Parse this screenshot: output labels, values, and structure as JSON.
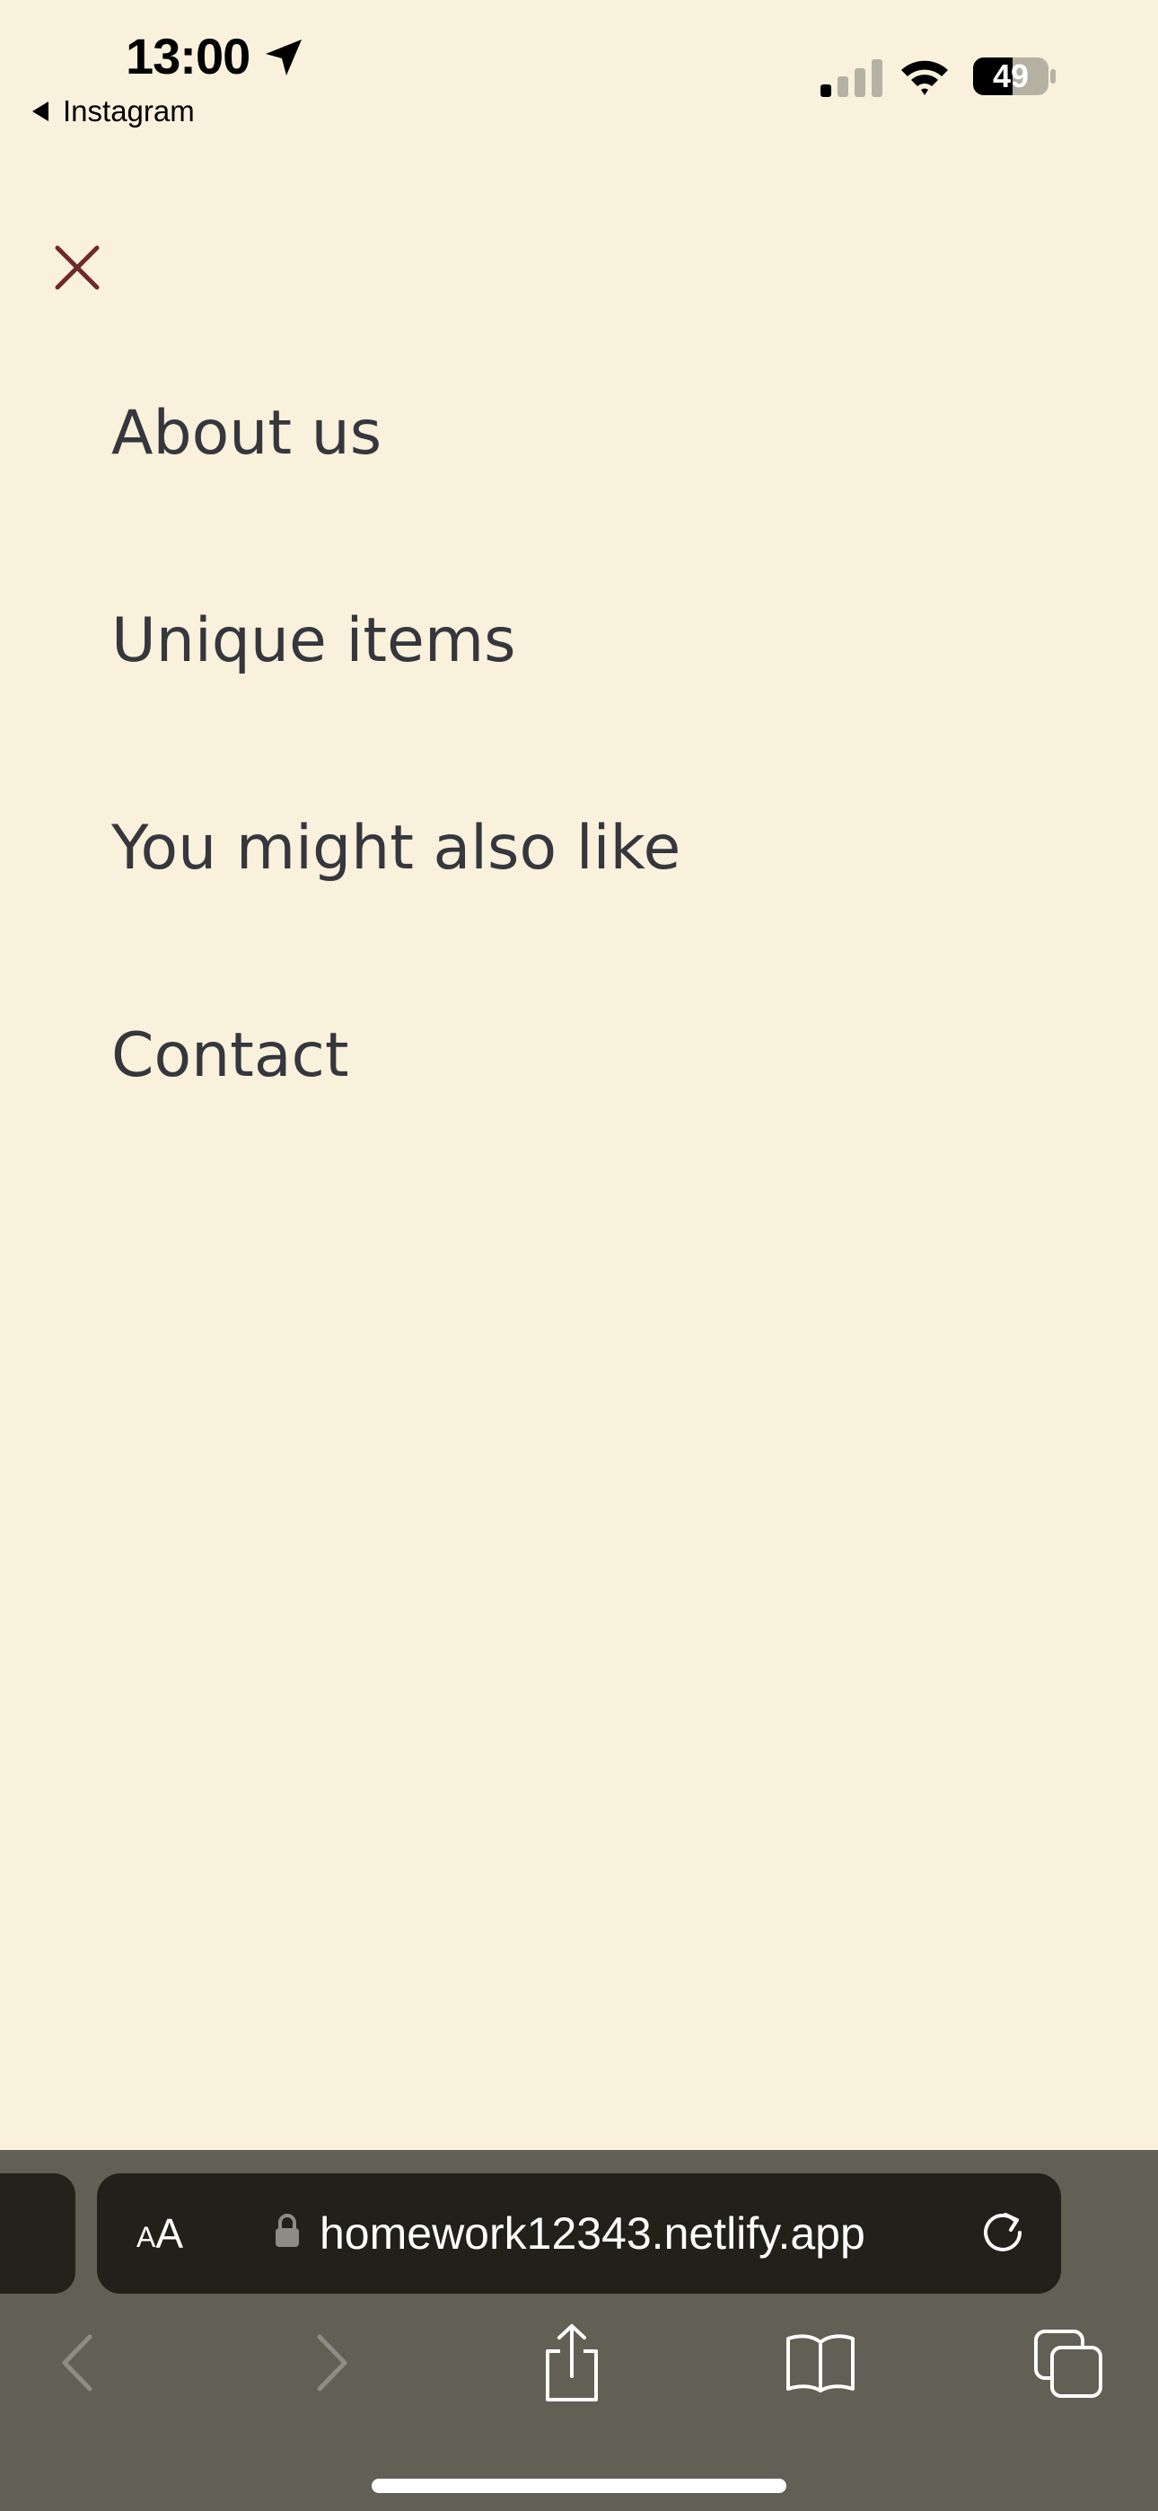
{
  "status_bar": {
    "time": "13:00",
    "back_app": "Instagram",
    "battery": "49",
    "icons": [
      "location-arrow-icon",
      "cellular-signal-icon",
      "wifi-icon",
      "battery-icon"
    ]
  },
  "menu": {
    "close_icon": "close-icon",
    "close_color": "#6e2a2a",
    "items": [
      {
        "label": "About us"
      },
      {
        "label": "Unique items"
      },
      {
        "label": "You might also like"
      },
      {
        "label": "Contact"
      }
    ]
  },
  "browser": {
    "text_size_label_small": "A",
    "text_size_label_large": "A",
    "url": "homework12343.netlify.app",
    "icons": [
      "lock-icon",
      "reload-icon",
      "back-icon",
      "forward-icon",
      "share-icon",
      "bookmarks-icon",
      "tabs-icon"
    ]
  },
  "colors": {
    "page_background": "#f9f1dc",
    "menu_text": "#35373d",
    "toolbar_background": "#626055",
    "url_pill": "#22201a"
  }
}
